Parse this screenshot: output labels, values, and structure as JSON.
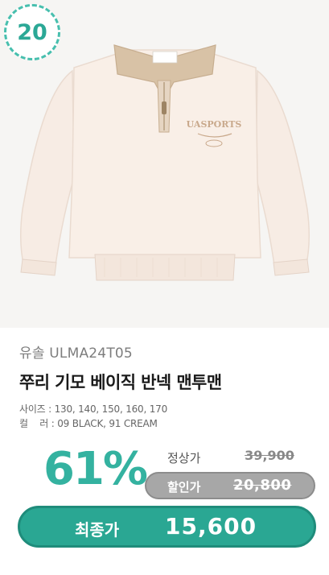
{
  "rank": "20",
  "product": {
    "brand_code": "유솔 ULMA24T05",
    "name": "쭈리 기모 베이직 반넥 맨투맨",
    "sizes": "사이즈 : 130, 140, 150, 160, 170",
    "colors": "컬    러 : 09 BLACK, 91 CREAM",
    "garment_logo": "UASPORTS"
  },
  "pricing": {
    "discount": "61%",
    "regular_label": "정상가",
    "regular_price": "39,900",
    "sale_label": "할인가",
    "sale_price": "20,800",
    "final_label": "최종가",
    "final_price": "15,600"
  },
  "colors": {
    "accent": "#2aa793",
    "badge_border": "#47bfae",
    "sale_pill": "#a7a7a7",
    "garment_body": "#f7ece4",
    "garment_collar": "#d8c2a6"
  }
}
